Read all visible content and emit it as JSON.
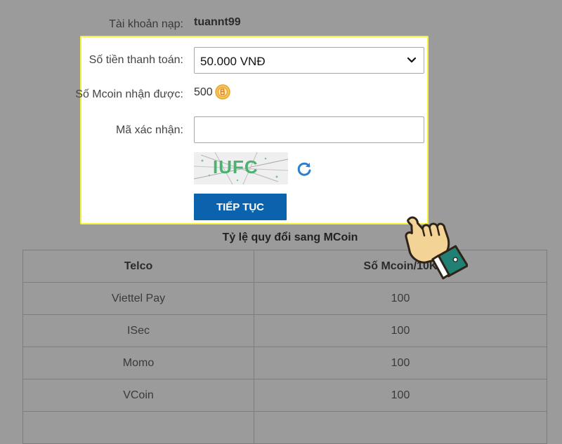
{
  "account": {
    "label": "Tài khoản nạp:",
    "value": "tuannt99"
  },
  "form": {
    "amount_label": "Số tiền thanh toán:",
    "amount_selected": "50.000 VNĐ",
    "mcoin_label": "Số Mcoin nhận được:",
    "mcoin_value": "500",
    "captcha_label": "Mã xác nhận:",
    "captcha_input_value": "",
    "captcha_image_text": "IUFC",
    "continue_label": "TIẾP TỤC"
  },
  "icons": {
    "select_arrow": "chevron-down-icon",
    "mcoin": "coin-icon",
    "refresh": "refresh-icon",
    "pointer": "pointing-hand-icon"
  },
  "rates": {
    "title": "Tỷ lệ quy đổi sang MCoin",
    "headers": [
      "Telco",
      "Số Mcoin/10K"
    ],
    "rows": [
      [
        "Viettel Pay",
        "100"
      ],
      [
        "ISec",
        "100"
      ],
      [
        "Momo",
        "100"
      ],
      [
        "VCoin",
        "100"
      ],
      [
        "",
        ""
      ]
    ]
  },
  "colors": {
    "overlay": "#9b9b9b",
    "panel_border": "#f6f239",
    "button": "#0b62ad",
    "captcha_text": "#49b36f",
    "refresh": "#2b7fd0"
  }
}
